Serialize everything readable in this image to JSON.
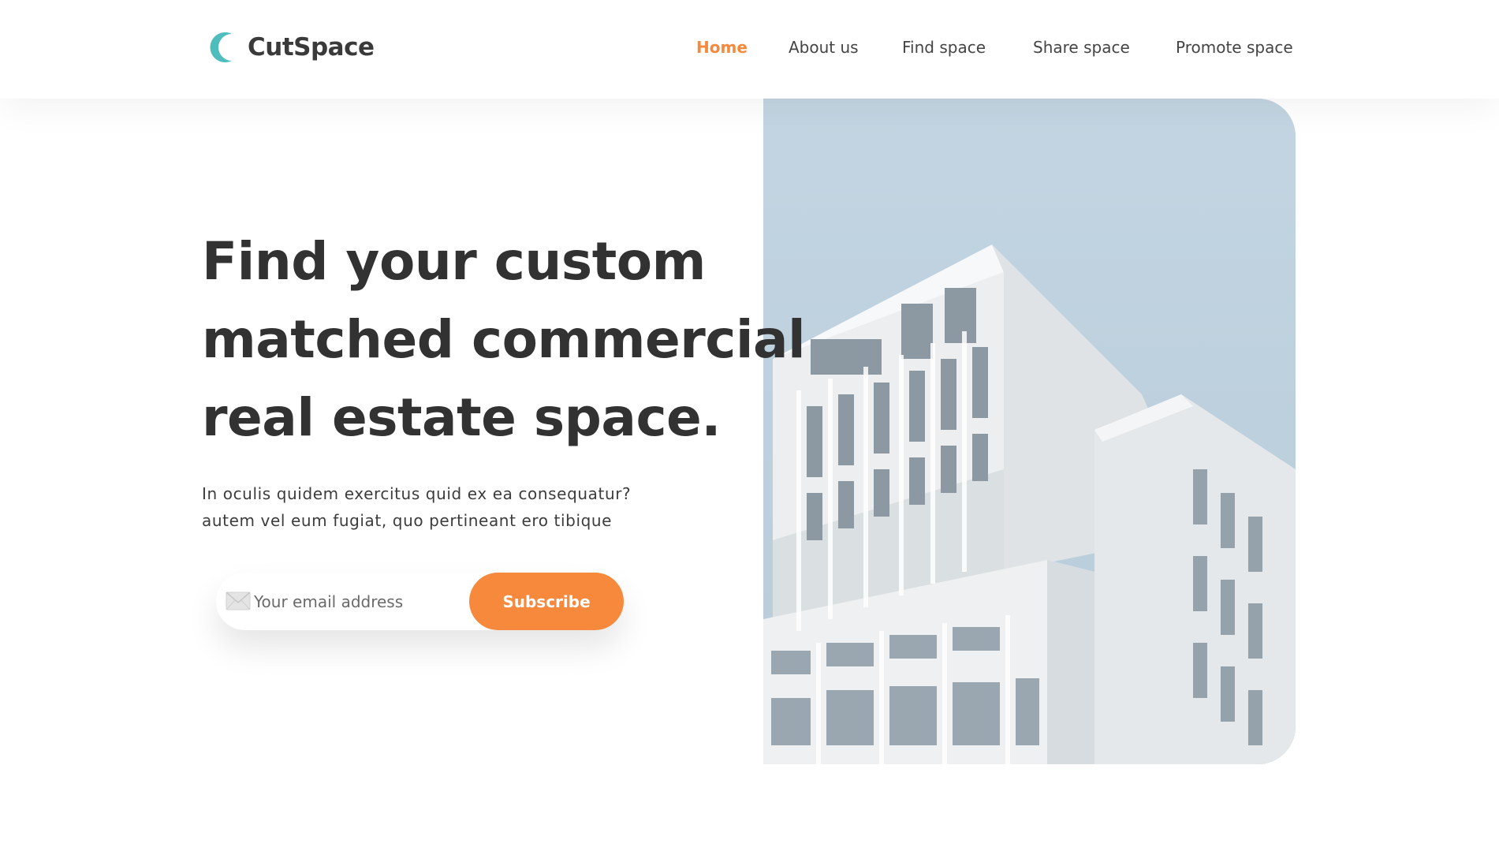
{
  "brand": {
    "name": "CutSpace",
    "logo_icon": "crescent-logo-icon",
    "logo_color": "#4fbdbd"
  },
  "nav": {
    "items": [
      {
        "label": "Home",
        "active": true
      },
      {
        "label": "About us",
        "active": false
      },
      {
        "label": "Find space",
        "active": false
      },
      {
        "label": "Share space",
        "active": false
      },
      {
        "label": "Promote space",
        "active": false
      }
    ]
  },
  "hero": {
    "headline_lines": [
      "Find your custom",
      "matched commercial",
      "real estate space."
    ],
    "subtext_lines": [
      "In oculis quidem exercitus quid ex ea consequatur?",
      "autem vel eum fugiat, quo pertineant ero tibique"
    ],
    "image": "white-modern-building-photo"
  },
  "subscribe": {
    "placeholder": "Your email address",
    "value": "",
    "button_label": "Subscribe",
    "icon": "mail-icon"
  },
  "colors": {
    "accent": "#f6893b",
    "text": "#333333",
    "sky": "#c3d4e0"
  }
}
